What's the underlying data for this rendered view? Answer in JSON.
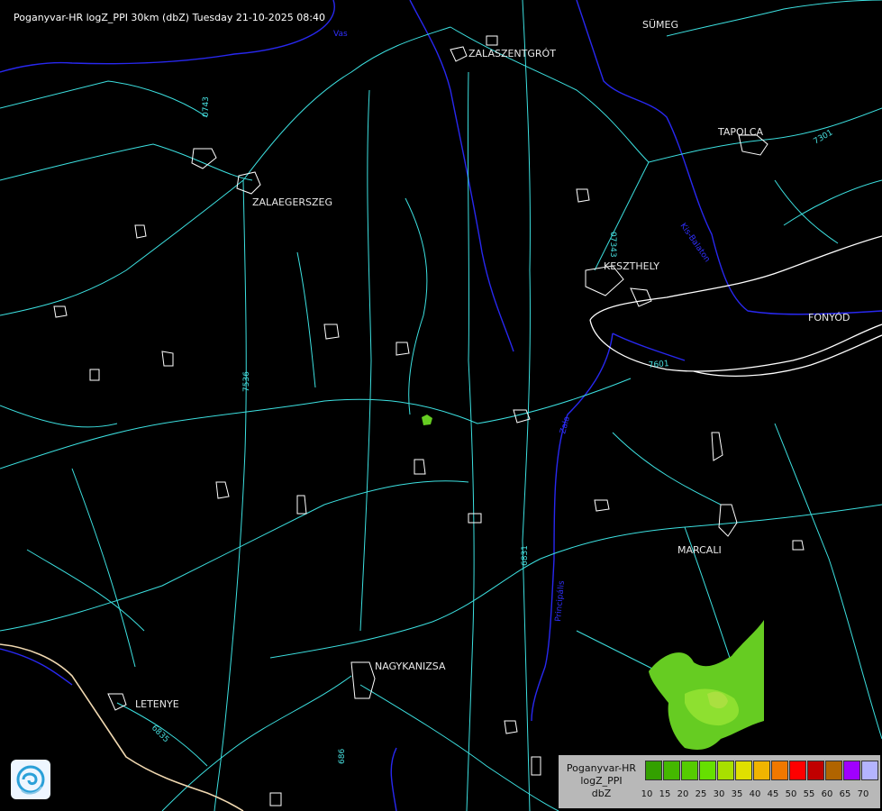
{
  "header": {
    "title": "Poganyvar-HR logZ_PPI 30km (dbZ) Tuesday 21-10-2025 08:40"
  },
  "towns": [
    "SÜMEG",
    "ZALASZENTGRÓT",
    "TAPOLCA",
    "ZALAEGERSZEG",
    "KESZTHELY",
    "FONYÓD",
    "MARCALI",
    "NAGYKANIZSA",
    "LETENYE"
  ],
  "road_labels": [
    "0743",
    "07343",
    "7301",
    "7536",
    "6831",
    "6835",
    "686",
    "7601"
  ],
  "river_labels": [
    "Zala",
    "Vas",
    "Kis-Balaton",
    "Principális"
  ],
  "legend": {
    "name_lines": [
      "Poganyvar-HR",
      "logZ_PPI",
      "dbZ"
    ],
    "colors": [
      "#33a000",
      "#44b800",
      "#55cc00",
      "#66e000",
      "#a8e000",
      "#e0e000",
      "#f0b400",
      "#f07800",
      "#ff0000",
      "#c00000",
      "#b06400",
      "#a000ff",
      "#b4b4ff"
    ],
    "ticks": [
      "10",
      "15",
      "20",
      "25",
      "30",
      "35",
      "40",
      "45",
      "50",
      "55",
      "60",
      "65",
      "70"
    ]
  },
  "colors": {
    "roads": "#3ce0e0",
    "settlements": "#ffffff",
    "rivers": "#2828f0",
    "border": "#f0d8b0",
    "echo": "#66cc22"
  }
}
